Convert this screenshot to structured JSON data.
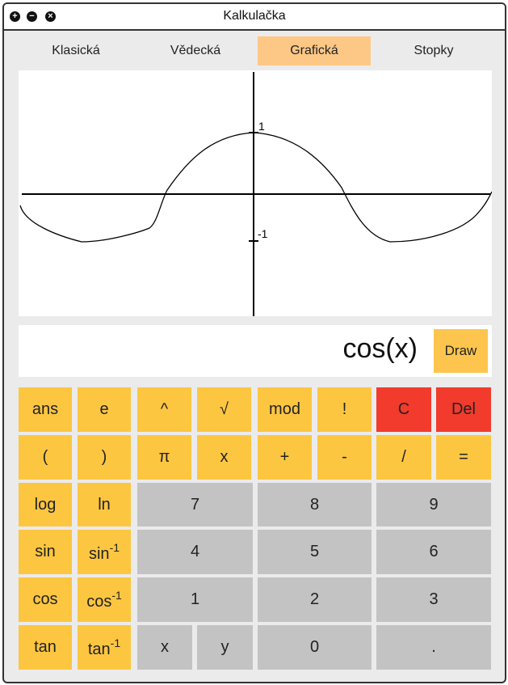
{
  "window": {
    "title": "Kalkulačka",
    "buttons": [
      "+",
      "−",
      "×"
    ]
  },
  "tabs": [
    {
      "label": "Klasická",
      "active": false
    },
    {
      "label": "Vědecká",
      "active": false
    },
    {
      "label": "Grafická",
      "active": true
    },
    {
      "label": "Stopky",
      "active": false
    }
  ],
  "graph": {
    "label_max": "1",
    "label_min": "-1"
  },
  "expression": "cos(x)",
  "draw_label": "Draw",
  "keys": {
    "row1": [
      "ans",
      "e",
      "^",
      "√",
      "mod",
      "!",
      "C",
      "Del"
    ],
    "row2": [
      "(",
      ")",
      "π",
      "x",
      "+",
      "-",
      "/",
      "="
    ],
    "fn_log": "log",
    "fn_ln": "ln",
    "fn_sin": "sin",
    "fn_asin": "sin",
    "fn_cos": "cos",
    "fn_acos": "cos",
    "fn_tan": "tan",
    "fn_atan": "tan",
    "inv_sup": "-1",
    "digits": [
      "7",
      "8",
      "9",
      "4",
      "5",
      "6",
      "1",
      "2",
      "3"
    ],
    "var_x": "x",
    "var_y": "y",
    "zero": "0",
    "dot": "."
  },
  "colors": {
    "accent": "#fdc641",
    "danger": "#f23b2c",
    "active_tab": "#fdc886",
    "digit": "#c3c3c3"
  }
}
